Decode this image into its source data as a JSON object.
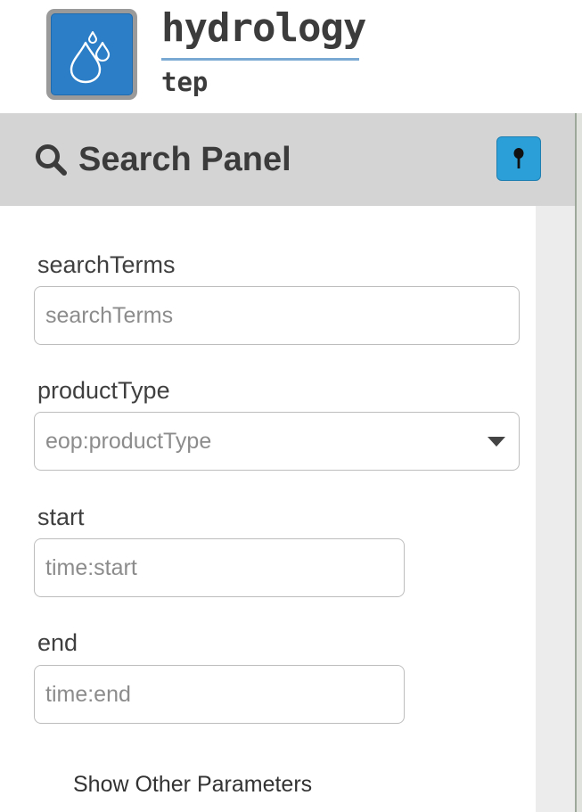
{
  "brand": {
    "title": "hydrology",
    "subtitle": "tep",
    "logo_icon": "water-drops-icon",
    "colors": {
      "logo_blue": "#2c7ec6",
      "rule_blue": "#7aaad4"
    }
  },
  "panel": {
    "title": "Search Panel",
    "title_icon": "search-icon",
    "pin_icon": "pin-icon",
    "colors": {
      "bar": "#d4d4d4",
      "pin_button": "#2b9fd8"
    }
  },
  "form": {
    "search_terms": {
      "label": "searchTerms",
      "placeholder": "searchTerms",
      "value": ""
    },
    "product_type": {
      "label": "productType",
      "selected": "eop:productType"
    },
    "start": {
      "label": "start",
      "placeholder": "time:start",
      "value": ""
    },
    "end": {
      "label": "end",
      "placeholder": "time:end",
      "value": ""
    },
    "show_other_label": "Show Other Parameters"
  }
}
